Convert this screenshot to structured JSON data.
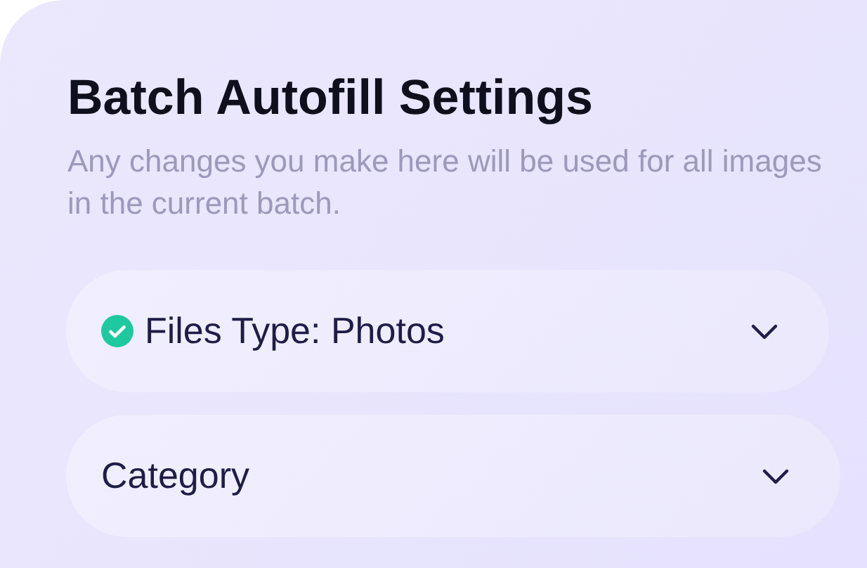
{
  "panel": {
    "title": "Batch Autofill Settings",
    "description": "Any changes you make here will be used for all images in the current batch."
  },
  "dropdowns": [
    {
      "label": "Files Type: Photos",
      "checked": true
    },
    {
      "label": "Category",
      "checked": false
    }
  ]
}
